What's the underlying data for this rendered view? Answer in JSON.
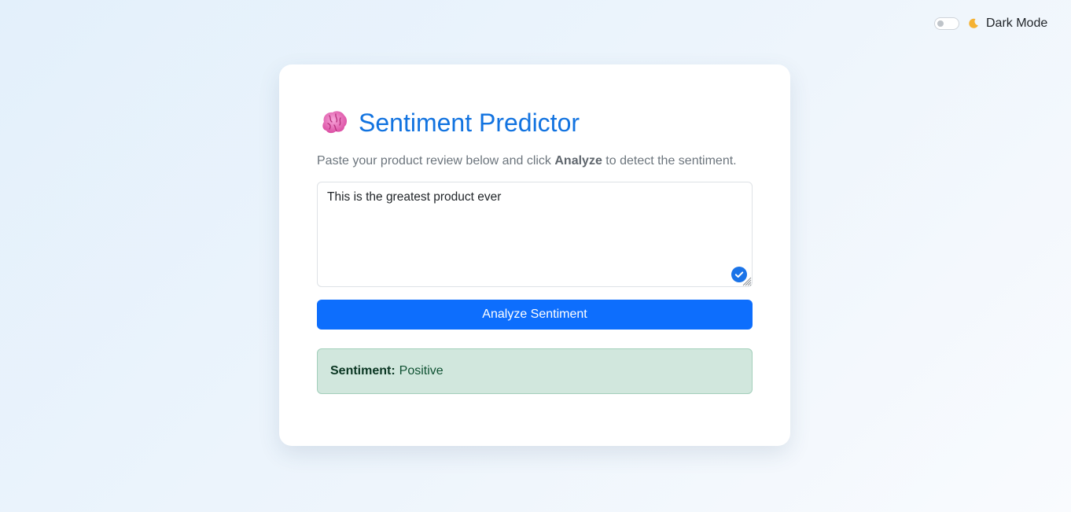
{
  "dark_mode": {
    "label": "Dark Mode",
    "enabled": false,
    "icon": "moon-icon"
  },
  "card": {
    "icon": "brain-icon",
    "title": "Sentiment Predictor",
    "subtitle": {
      "before": "Paste your product review below and click ",
      "emphasis": "Analyze",
      "after": " to detect the sentiment."
    },
    "review_input": {
      "value": "This is the greatest product ever"
    },
    "analyze_button": "Analyze Sentiment",
    "result": {
      "label": "Sentiment:",
      "value": "Positive"
    }
  },
  "colors": {
    "accent": "#0d6efd",
    "title": "#1273e0",
    "success_bg": "#d1e7dd",
    "success_border": "#a3cfbb"
  }
}
